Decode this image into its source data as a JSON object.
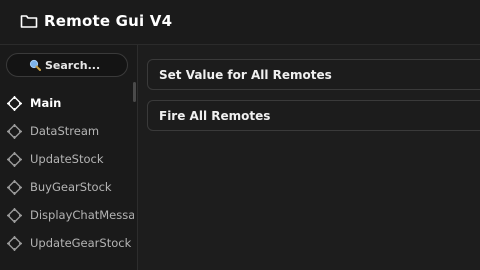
{
  "window": {
    "title": "Remote Gui V4"
  },
  "search": {
    "placeholder": "Search..."
  },
  "sidebar": {
    "items": [
      {
        "label": "Main",
        "icon": "crosshair-icon",
        "active": true
      },
      {
        "label": "DataStream",
        "icon": "crosshair-icon",
        "active": false
      },
      {
        "label": "UpdateStock",
        "icon": "crosshair-icon",
        "active": false
      },
      {
        "label": "BuyGearStock",
        "icon": "crosshair-icon",
        "active": false
      },
      {
        "label": "DisplayChatMessa",
        "icon": "crosshair-icon",
        "active": false
      },
      {
        "label": "UpdateGearStock",
        "icon": "crosshair-icon",
        "active": false
      }
    ]
  },
  "main": {
    "buttons": [
      {
        "label": "Set Value for All Remotes"
      },
      {
        "label": "Fire All Remotes"
      }
    ]
  },
  "colors": {
    "background": "#1f1f1f",
    "border": "#3a3a3a",
    "text_active": "#ffffff",
    "text_inactive": "#b4b4b4"
  }
}
